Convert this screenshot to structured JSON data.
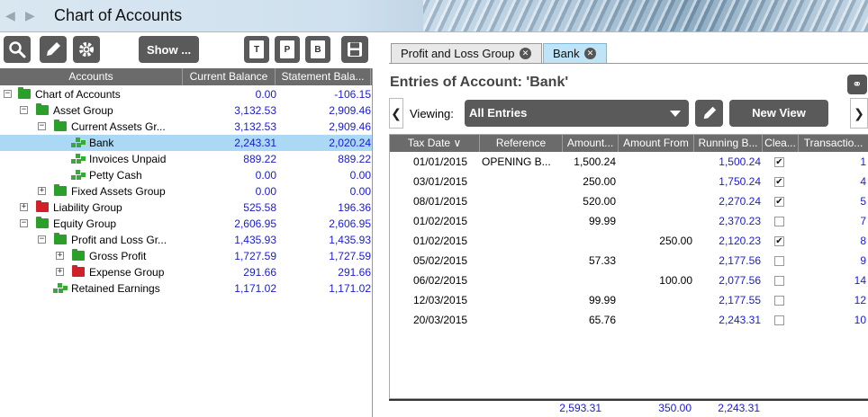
{
  "window": {
    "title": "Chart of Accounts"
  },
  "toolbar": {
    "show_label": "Show ...",
    "doc_t": "T",
    "doc_p": "P",
    "doc_b": "B"
  },
  "tree": {
    "headers": [
      "Accounts",
      "Current Balance",
      "Statement Bala..."
    ],
    "rows": [
      {
        "label": "Chart of Accounts",
        "current": "0.00",
        "statement": "-106.15"
      },
      {
        "label": "Asset Group",
        "current": "3,132.53",
        "statement": "2,909.46"
      },
      {
        "label": "Current Assets Gr...",
        "current": "3,132.53",
        "statement": "2,909.46"
      },
      {
        "label": "Bank",
        "current": "2,243.31",
        "statement": "2,020.24"
      },
      {
        "label": "Invoices Unpaid",
        "current": "889.22",
        "statement": "889.22"
      },
      {
        "label": "Petty Cash",
        "current": "0.00",
        "statement": "0.00"
      },
      {
        "label": "Fixed Assets Group",
        "current": "0.00",
        "statement": "0.00"
      },
      {
        "label": "Liability Group",
        "current": "525.58",
        "statement": "196.36"
      },
      {
        "label": "Equity Group",
        "current": "2,606.95",
        "statement": "2,606.95"
      },
      {
        "label": "Profit and Loss Gr...",
        "current": "1,435.93",
        "statement": "1,435.93"
      },
      {
        "label": "Gross Profit",
        "current": "1,727.59",
        "statement": "1,727.59"
      },
      {
        "label": "Expense Group",
        "current": "291.66",
        "statement": "291.66"
      },
      {
        "label": "Retained Earnings",
        "current": "1,171.02",
        "statement": "1,171.02"
      }
    ]
  },
  "tabs": [
    {
      "label": "Profit and Loss Group"
    },
    {
      "label": "Bank"
    }
  ],
  "entries": {
    "title": "Entries of Account:  'Bank'",
    "viewing_label": "Viewing:",
    "viewing_value": "All Entries",
    "new_view_label": "New View",
    "headers": [
      "Tax Date",
      "Reference",
      "Amount...",
      "Amount From",
      "Running B...",
      "Clea...",
      "Transactio..."
    ],
    "rows": [
      {
        "date": "01/01/2015",
        "ref": "OPENING B...",
        "amt_to": "1,500.24",
        "amt_from": "",
        "running": "1,500.24",
        "cleared": true,
        "txn": "1"
      },
      {
        "date": "03/01/2015",
        "ref": "",
        "amt_to": "250.00",
        "amt_from": "",
        "running": "1,750.24",
        "cleared": true,
        "txn": "4"
      },
      {
        "date": "08/01/2015",
        "ref": "",
        "amt_to": "520.00",
        "amt_from": "",
        "running": "2,270.24",
        "cleared": true,
        "txn": "5"
      },
      {
        "date": "01/02/2015",
        "ref": "",
        "amt_to": "99.99",
        "amt_from": "",
        "running": "2,370.23",
        "cleared": false,
        "txn": "7"
      },
      {
        "date": "01/02/2015",
        "ref": "",
        "amt_to": "",
        "amt_from": "250.00",
        "running": "2,120.23",
        "cleared": true,
        "txn": "8"
      },
      {
        "date": "05/02/2015",
        "ref": "",
        "amt_to": "57.33",
        "amt_from": "",
        "running": "2,177.56",
        "cleared": false,
        "txn": "9"
      },
      {
        "date": "06/02/2015",
        "ref": "",
        "amt_to": "",
        "amt_from": "100.00",
        "running": "2,077.56",
        "cleared": false,
        "txn": "14"
      },
      {
        "date": "12/03/2015",
        "ref": "",
        "amt_to": "99.99",
        "amt_from": "",
        "running": "2,177.55",
        "cleared": false,
        "txn": "12"
      },
      {
        "date": "20/03/2015",
        "ref": "",
        "amt_to": "65.76",
        "amt_from": "",
        "running": "2,243.31",
        "cleared": false,
        "txn": "10"
      }
    ],
    "totals": {
      "amt_to": "2,593.31",
      "amt_from": "350.00",
      "running": "2,243.31"
    }
  },
  "colors": {
    "folder_green": "#2aa02a",
    "folder_red": "#d0202a",
    "value_blue": "#1a1ad0",
    "selected_row": "#aad8f5",
    "button_gray": "#5a5a5a"
  }
}
